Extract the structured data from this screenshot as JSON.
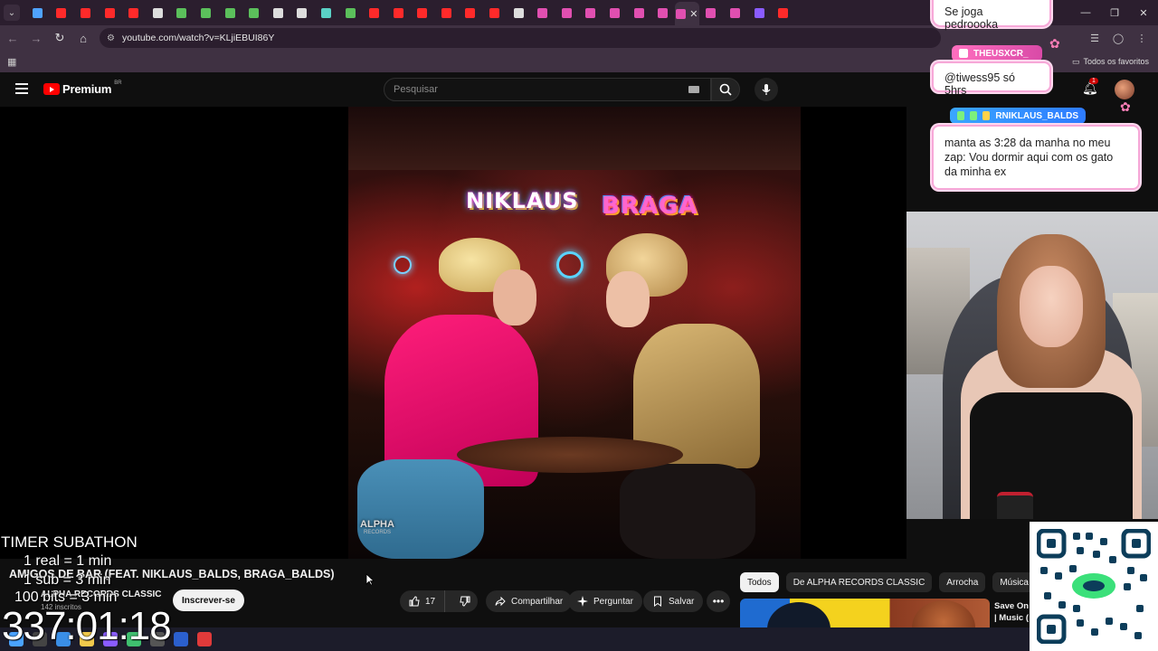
{
  "browser": {
    "url": "youtube.com/watch?v=KLjiEBUI86Y",
    "all_favorites_label": "Todos os favoritos",
    "tab_colors": [
      "#4fa3ff",
      "#ff2a2a",
      "#ff2a2a",
      "#ff2a2a",
      "#ff2a2a",
      "#dddddd",
      "#5bbf5b",
      "#5bbf5b",
      "#5bbf5b",
      "#5bbf5b",
      "#dddddd",
      "#dddddd",
      "#5ad1c6",
      "#5bbf5b",
      "#ff2a2a",
      "#ff2a2a",
      "#ff2a2a",
      "#ff2a2a",
      "#ff2a2a",
      "#ff2a2a",
      "#dddddd",
      "#e04fb0",
      "#e04fb0",
      "#e04fb0",
      "#e04fb0",
      "#e04fb0",
      "#e04fb0",
      "#e04fb0",
      "#e04fb0",
      "#e04fb0",
      "#8a5cff",
      "#ff2a2a"
    ]
  },
  "youtube": {
    "logo_text": "Premium",
    "logo_country": "BR",
    "search_placeholder": "Pesquisar",
    "notifications_count": "1",
    "video": {
      "thumbnail_title_left": "NIKLAUS",
      "thumbnail_title_right": "BRAGA",
      "thumbnail_logo_line1": "ALPHA",
      "thumbnail_logo_line2": "RECORDS"
    },
    "title": "AMIGOS DE BAR (FEAT. NIKLAUS_BALDS, BRAGA_BALDS)",
    "channel_name": "ALPHA RECORDS CLASSIC",
    "subscribers": "142 inscritos",
    "subscribe_label": "Inscrever-se",
    "like_count": "17",
    "share_label": "Compartilhar",
    "ask_label": "Perguntar",
    "save_label": "Salvar",
    "chips": [
      "Todos",
      "De ALPHA RECORDS CLASSIC",
      "Arrocha",
      "Música brasil"
    ],
    "rec_title_line1": "Save On",
    "rec_title_line2": "| Music ("
  },
  "chat": {
    "message1": "Se joga pedroooka",
    "user2": "THEUSXCR_",
    "message2": "@tiwess95 só 5hrs",
    "user3": "RNIKLAUS_BALDS",
    "message3": "manta as 3:28 da manha no meu zap: Vou dormir aqui com os gato da minha ex"
  },
  "stream_overlay": {
    "subathon_title": "TIMER SUBATHON",
    "rule1": "1 real = 1 min",
    "rule2": "1 sub = 3 min",
    "rule3": "100 bits = 3 min",
    "timer": "337:01:18"
  }
}
